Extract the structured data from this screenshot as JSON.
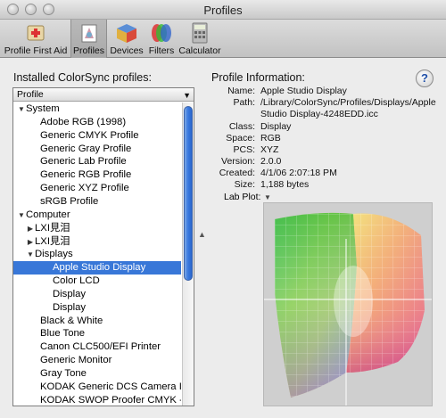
{
  "window": {
    "title": "Profiles"
  },
  "toolbar": {
    "items": [
      {
        "label": "Profile First Aid",
        "icon": "first-aid-icon"
      },
      {
        "label": "Profiles",
        "icon": "profiles-icon",
        "selected": true
      },
      {
        "label": "Devices",
        "icon": "devices-icon"
      },
      {
        "label": "Filters",
        "icon": "filters-icon"
      },
      {
        "label": "Calculator",
        "icon": "calculator-icon"
      }
    ]
  },
  "left": {
    "heading": "Installed ColorSync profiles:",
    "column_header": "Profile",
    "rows": [
      {
        "text": "System",
        "level": 0,
        "disclosure": "open"
      },
      {
        "text": "Adobe RGB (1998)",
        "level": 2
      },
      {
        "text": "Generic CMYK Profile",
        "level": 2
      },
      {
        "text": "Generic Gray Profile",
        "level": 2
      },
      {
        "text": "Generic Lab Profile",
        "level": 2
      },
      {
        "text": "Generic RGB Profile",
        "level": 2
      },
      {
        "text": "Generic XYZ Profile",
        "level": 2
      },
      {
        "text": "sRGB Profile",
        "level": 2
      },
      {
        "text": "Computer",
        "level": 0,
        "disclosure": "open"
      },
      {
        "text": "LXΙ見泪",
        "level": 1,
        "disclosure": "closed"
      },
      {
        "text": "LXΙ見泪",
        "level": 1,
        "disclosure": "closed"
      },
      {
        "text": "Displays",
        "level": 1,
        "disclosure": "open"
      },
      {
        "text": "Apple Studio Display",
        "level": 3,
        "selected": true
      },
      {
        "text": "Color LCD",
        "level": 3
      },
      {
        "text": "Display",
        "level": 3
      },
      {
        "text": "Display",
        "level": 3
      },
      {
        "text": "Black & White",
        "level": 2
      },
      {
        "text": "Blue Tone",
        "level": 2
      },
      {
        "text": "Canon CLC500/EFI Printer",
        "level": 2
      },
      {
        "text": "Generic Monitor",
        "level": 2
      },
      {
        "text": "Gray Tone",
        "level": 2
      },
      {
        "text": "KODAK Generic DCS Camera Input",
        "level": 2
      },
      {
        "text": "KODAK SWOP Proofer CMYK - Coated",
        "level": 2
      }
    ]
  },
  "right": {
    "heading": "Profile Information:",
    "help": "?",
    "info": [
      {
        "key": "Name:",
        "value": "Apple Studio Display"
      },
      {
        "key": "Path:",
        "value": "/Library/ColorSync/Profiles/Displays/Apple Studio Display-4248EDD.icc"
      },
      {
        "key": "Class:",
        "value": "Display"
      },
      {
        "key": "Space:",
        "value": "RGB"
      },
      {
        "key": "PCS:",
        "value": "XYZ"
      },
      {
        "key": "Version:",
        "value": "2.0.0"
      },
      {
        "key": "Created:",
        "value": "4/1/06 2:07:18 PM"
      },
      {
        "key": "Size:",
        "value": "1,188 bytes"
      }
    ],
    "lab_plot_label": "Lab Plot:"
  },
  "colors": {
    "selection": "#3877d8",
    "scroll_thumb": "#3c7be0"
  }
}
